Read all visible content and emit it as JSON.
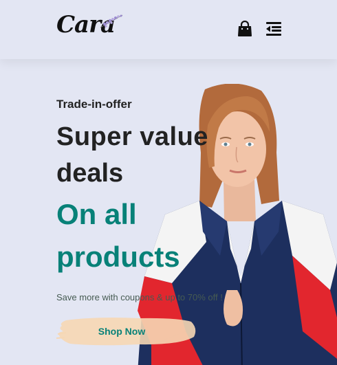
{
  "header": {
    "logo_text": "Cara",
    "icons": [
      "shopping-bag-icon",
      "menu-icon"
    ]
  },
  "hero": {
    "eyebrow": "Trade-in-offer",
    "headline_line1": "Super value",
    "headline_line2": "deals",
    "accent_line1": "On all",
    "accent_line2": "products",
    "subtext": "Save more with coupons & up to 70% off !",
    "cta_label": "Shop Now"
  },
  "colors": {
    "background": "#e3e6f3",
    "accent": "#088178",
    "text": "#222222",
    "button_brush": "#f6d7b4"
  }
}
